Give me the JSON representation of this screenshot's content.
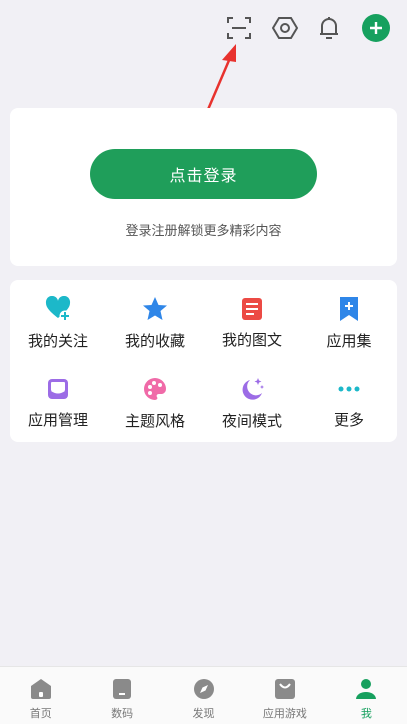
{
  "top_bar": {
    "icons": [
      "scan-icon",
      "settings-icon",
      "bell-icon",
      "add-icon"
    ],
    "accent_color": "#16a05e"
  },
  "login_card": {
    "button_label": "点击登录",
    "hint": "登录注册解锁更多精彩内容",
    "button_color": "#1f9e5a"
  },
  "menu": {
    "items": [
      {
        "label": "我的关注",
        "icon": "heart-plus-icon",
        "color": "#1cb8c9"
      },
      {
        "label": "我的收藏",
        "icon": "star-icon",
        "color": "#2f86e8"
      },
      {
        "label": "我的图文",
        "icon": "document-icon",
        "color": "#ec4a44"
      },
      {
        "label": "应用集",
        "icon": "bookmark-plus-icon",
        "color": "#2f86e8"
      },
      {
        "label": "应用管理",
        "icon": "inbox-icon",
        "color": "#9c6ce6"
      },
      {
        "label": "主题风格",
        "icon": "palette-icon",
        "color": "#f06aa8"
      },
      {
        "label": "夜间模式",
        "icon": "moon-icon",
        "color": "#9c6ce6"
      },
      {
        "label": "更多",
        "icon": "more-dots-icon",
        "color": "#1cb8c9"
      }
    ]
  },
  "bottom_nav": {
    "items": [
      {
        "label": "首页",
        "icon": "home-icon"
      },
      {
        "label": "数码",
        "icon": "phone-icon"
      },
      {
        "label": "发现",
        "icon": "compass-icon"
      },
      {
        "label": "应用游戏",
        "icon": "bag-icon"
      },
      {
        "label": "我",
        "icon": "user-icon",
        "active": true
      }
    ],
    "active_color": "#16a05e",
    "inactive_color": "#8a8a8a"
  }
}
